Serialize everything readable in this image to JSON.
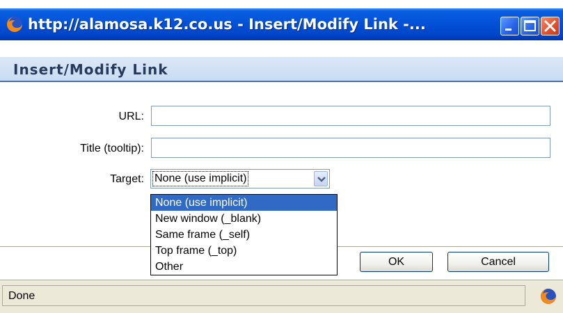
{
  "window": {
    "title": "http://alamosa.k12.co.us - Insert/Modify Link -...",
    "icon": "firefox-icon",
    "controls": [
      "minimize-icon",
      "maximize-icon",
      "close-icon"
    ]
  },
  "dialog": {
    "heading": "Insert/Modify Link",
    "url_label": "URL:",
    "url_value": "",
    "title_label": "Title (tooltip):",
    "title_value": "",
    "target_label": "Target:",
    "target_selected": "None (use implicit)",
    "target_options": [
      "None (use implicit)",
      "New window (_blank)",
      "Same frame (_self)",
      "Top frame (_top)",
      "Other"
    ],
    "ok_label": "OK",
    "cancel_label": "Cancel"
  },
  "status": {
    "text": "Done",
    "icon": "firefox-icon"
  },
  "colors": {
    "titlebar": "#0252d8",
    "selection": "#316ac5",
    "header_band": "#c9dcf2",
    "close_button": "#e0502c"
  }
}
